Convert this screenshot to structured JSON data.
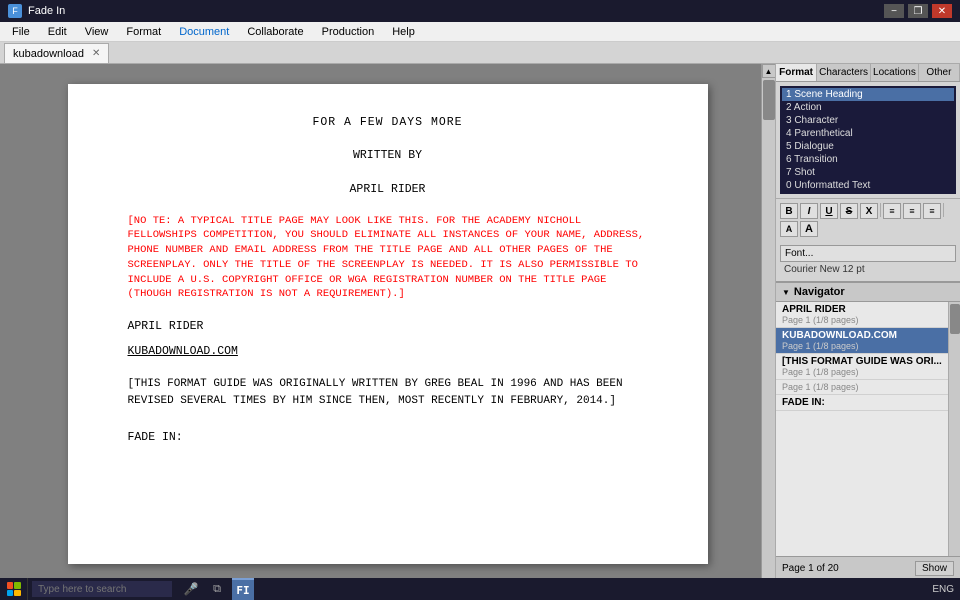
{
  "app": {
    "title": "Fade In",
    "icon_label": "F"
  },
  "title_bar": {
    "title": "Fade In",
    "min": "−",
    "max": "❐",
    "close": "✕"
  },
  "menu_bar": {
    "items": [
      "File",
      "Edit",
      "View",
      "Format",
      "Document",
      "Collaborate",
      "Production",
      "Help"
    ]
  },
  "tab_bar": {
    "tabs": [
      {
        "label": "kubadownload",
        "active": true
      }
    ]
  },
  "document": {
    "line1": "FOR A FEW DAYS MORE",
    "line2": "WRITTEN BY",
    "line3": "APRIL RIDER",
    "note": "[NO TE: A TYPICAL TITLE PAGE MAY LOOK LIKE THIS. FOR THE ACADEMY NICHOLL FELLOWSHIPS COMPETITION, YOU SHOULD ELIMINATE ALL INSTANCES OF YOUR NAME, ADDRESS, PHONE NUMBER AND EMAIL ADDRESS FROM THE TITLE PAGE AND ALL OTHER PAGES OF THE SCREENPLAY. ONLY THE TITLE OF THE SCREENPLAY IS NEEDED. IT IS ALSO PERMISSIBLE TO INCLUDE A U.S. COPYRIGHT OFFICE OR WGA REGISTRATION NUMBER ON THE TITLE PAGE (THOUGH REGISTRATION IS NOT A REQUIREMENT).]",
    "author2": "APRIL RIDER",
    "website": "KUBADOWNLOAD.COM",
    "footer_note": "[THIS FORMAT GUIDE WAS ORIGINALLY WRITTEN BY GREG BEAL IN 1996 AND HAS BEEN REVISED SEVERAL TIMES BY HIM SINCE THEN, MOST RECENTLY IN FEBRUARY, 2014.]",
    "scene": "FADE IN:"
  },
  "right_panel": {
    "tabs": [
      "Format",
      "Characters",
      "Locations",
      "Other"
    ],
    "active_tab": "Format"
  },
  "format_list": {
    "items": [
      {
        "id": 1,
        "label": "Scene Heading",
        "selected": true
      },
      {
        "id": 2,
        "label": "Action"
      },
      {
        "id": 3,
        "label": "Character"
      },
      {
        "id": 4,
        "label": "Parenthetical"
      },
      {
        "id": 5,
        "label": "Dialogue"
      },
      {
        "id": 6,
        "label": "Transition"
      },
      {
        "id": 7,
        "label": "Shot"
      },
      {
        "id": 0,
        "label": "Unformatted Text"
      }
    ]
  },
  "format_buttons": {
    "bold": "B",
    "italic": "I",
    "underline": "U",
    "strikethrough": "S",
    "other": "X",
    "align_left": "≡",
    "align_center": "≡",
    "align_right": "≡",
    "size_down": "A",
    "size_up": "A"
  },
  "font": {
    "button_label": "Font...",
    "current": "Courier New 12 pt"
  },
  "navigator": {
    "title": "Navigator",
    "items": [
      {
        "title": "APRIL RIDER",
        "sub": "Page 1 (1/8 pages)",
        "selected": false
      },
      {
        "title": "KUBADOWNLOAD.COM",
        "sub": "Page 1 (1/8 pages)",
        "selected": true
      },
      {
        "title": "[THIS FORMAT GUIDE WAS ORI...",
        "sub": "Page 1 (1/8 pages)",
        "selected": false
      },
      {
        "title": "",
        "sub": "Page 1 (1/8 pages)",
        "selected": false
      },
      {
        "title": "FADE IN:",
        "sub": "",
        "selected": false
      }
    ],
    "footer": "Page 1 of 20",
    "show_btn": "Show"
  },
  "taskbar": {
    "search_placeholder": "Type here to search",
    "lang": "ENG",
    "app_icon": "FI"
  }
}
